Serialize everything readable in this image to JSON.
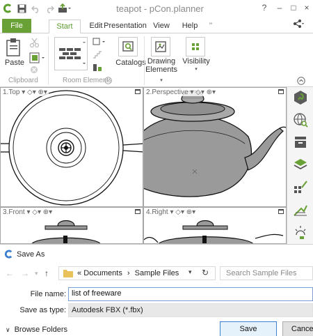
{
  "window": {
    "title": "teapot - pCon.planner",
    "help": "?",
    "minimize": "–",
    "restore": "□",
    "close": "×"
  },
  "ribbon": {
    "tabs": [
      "File",
      "Start",
      "Edit",
      "Presentation",
      "View",
      "Help"
    ],
    "more": "''",
    "active_tab": "Start",
    "buttons": {
      "paste": "Paste",
      "catalogs": "Catalogs",
      "drawing_elements_line1": "Drawing",
      "drawing_elements_line2": "Elements",
      "visibility": "Visibility"
    },
    "groups": {
      "clipboard": "Clipboard",
      "room_elements": "Room Elements"
    },
    "accent": "#6aa136"
  },
  "viewports": [
    {
      "label": "1.Top"
    },
    {
      "label": "2.Perspective"
    },
    {
      "label": "3.Front"
    },
    {
      "label": "4.Right"
    }
  ],
  "dialog": {
    "title": "Save As",
    "breadcrumb": {
      "prefix": "«",
      "items": [
        "Documents",
        "Sample Files"
      ],
      "separator": "›"
    },
    "search_placeholder": "Search Sample Files",
    "file_name_label": "File name:",
    "file_name_value": "list of freeware",
    "save_type_label": "Save as type:",
    "save_type_value": "Autodesk FBX (*.fbx)",
    "browse_folders": "Browse Folders",
    "save_button": "Save",
    "cancel_button": "Cancel"
  }
}
